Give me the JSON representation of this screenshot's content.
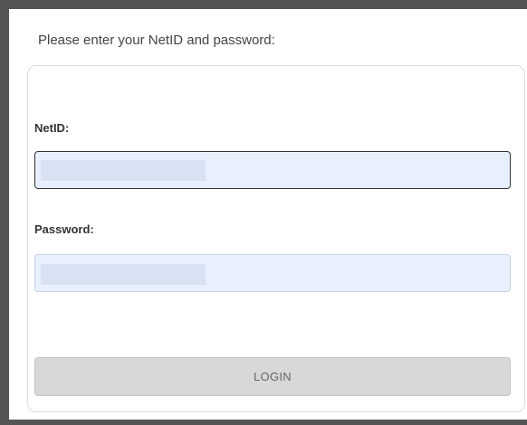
{
  "login_form": {
    "intro_text": "Please enter your NetID and password:",
    "netid": {
      "label": "NetID:",
      "value": "",
      "placeholder": ""
    },
    "password": {
      "label": "Password:",
      "value": "",
      "placeholder": ""
    },
    "login_button_label": "LOGIN"
  },
  "colors": {
    "frame": "#545454",
    "input_autofill_background": "#e8f0fe",
    "button_background": "#d8d8d8",
    "button_text": "#666666"
  }
}
